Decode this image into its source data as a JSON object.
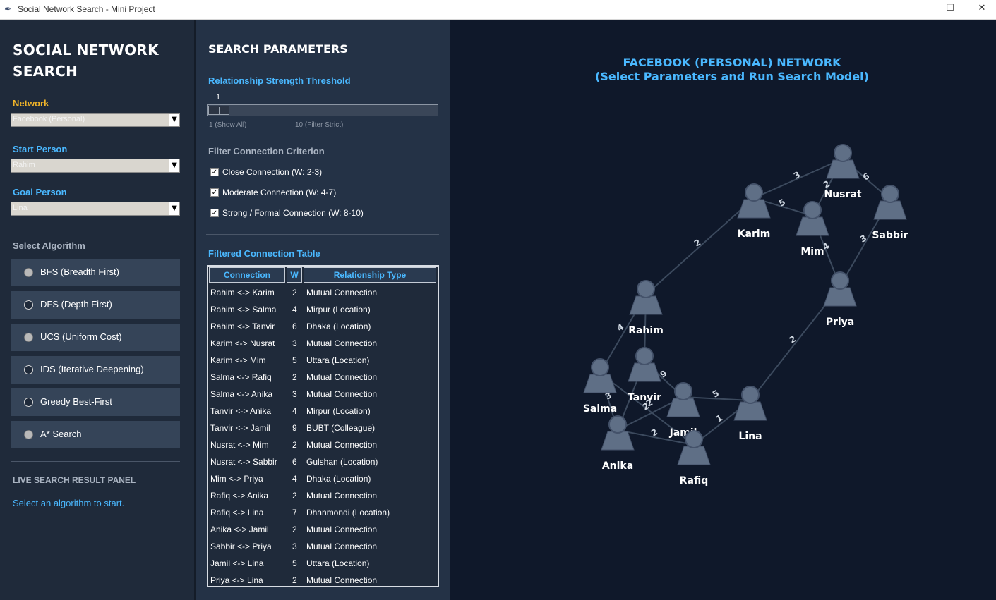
{
  "window": {
    "title": "Social Network Search - Mini Project",
    "minimize": "—",
    "maximize": "☐",
    "close": "✕"
  },
  "left": {
    "heading": "SOCIAL NETWORK SEARCH",
    "network_label": "Network",
    "network_value": "Facebook (Personal)",
    "start_label": "Start Person",
    "start_value": "Rahim",
    "goal_label": "Goal Person",
    "goal_value": "Lina",
    "algo_label": "Select Algorithm",
    "algorithms": [
      {
        "label": "BFS (Breadth First)",
        "filled": true
      },
      {
        "label": "DFS (Depth First)",
        "filled": false
      },
      {
        "label": "UCS (Uniform Cost)",
        "filled": true
      },
      {
        "label": "IDS (Iterative Deepening)",
        "filled": false
      },
      {
        "label": "Greedy Best-First",
        "filled": false
      },
      {
        "label": "A* Search",
        "filled": true
      }
    ],
    "live_title": "LIVE SEARCH RESULT PANEL",
    "live_message": "Select an algorithm to start."
  },
  "middle": {
    "heading": "SEARCH PARAMETERS",
    "threshold_label": "Relationship Strength Threshold",
    "threshold_value": "1",
    "threshold_min_label": "1 (Show All)",
    "threshold_max_label": "10 (Filter Strict)",
    "filter_title": "Filter Connection Criterion",
    "filters": [
      {
        "label": "Close Connection (W: 2-3)",
        "checked": true
      },
      {
        "label": "Moderate Connection (W: 4-7)",
        "checked": true
      },
      {
        "label": "Strong / Formal Connection (W: 8-10)",
        "checked": true
      }
    ],
    "table_title": "Filtered Connection Table",
    "table_headers": [
      "Connection",
      "W",
      "Relationship Type"
    ],
    "rows": [
      [
        "Rahim <-> Karim",
        "2",
        "Mutual Connection"
      ],
      [
        "Rahim <-> Salma",
        "4",
        "Mirpur (Location)"
      ],
      [
        "Rahim <-> Tanvir",
        "6",
        "Dhaka (Location)"
      ],
      [
        "Karim <-> Nusrat",
        "3",
        "Mutual Connection"
      ],
      [
        "Karim <-> Mim",
        "5",
        "Uttara (Location)"
      ],
      [
        "Salma <-> Rafiq",
        "2",
        "Mutual Connection"
      ],
      [
        "Salma <-> Anika",
        "3",
        "Mutual Connection"
      ],
      [
        "Tanvir <-> Anika",
        "4",
        "Mirpur (Location)"
      ],
      [
        "Tanvir <-> Jamil",
        "9",
        "BUBT (Colleague)"
      ],
      [
        "Nusrat <-> Mim",
        "2",
        "Mutual Connection"
      ],
      [
        "Nusrat <-> Sabbir",
        "6",
        "Gulshan (Location)"
      ],
      [
        "Mim <-> Priya",
        "4",
        "Dhaka (Location)"
      ],
      [
        "Rafiq <-> Anika",
        "2",
        "Mutual Connection"
      ],
      [
        "Rafiq <-> Lina",
        "7",
        "Dhanmondi (Location)"
      ],
      [
        "Anika <-> Jamil",
        "2",
        "Mutual Connection"
      ],
      [
        "Sabbir <-> Priya",
        "3",
        "Mutual Connection"
      ],
      [
        "Jamil <-> Lina",
        "5",
        "Uttara (Location)"
      ],
      [
        "Priya <-> Lina",
        "2",
        "Mutual Connection"
      ]
    ]
  },
  "graph": {
    "title_line1": "FACEBOOK (PERSONAL) NETWORK",
    "title_line2": "(Select Parameters and Run Search Model)",
    "nodes": [
      "Nusrat",
      "Karim",
      "Mim",
      "Sabbir",
      "Rahim",
      "Priya",
      "Salma",
      "Tanvir",
      "Jamil",
      "Lina",
      "Anika",
      "Rafiq"
    ],
    "edge_weights": [
      "3",
      "5",
      "2",
      "6",
      "2",
      "4",
      "3",
      "2",
      "4",
      "9",
      "3",
      "2",
      "5",
      "2",
      "1",
      "2"
    ],
    "colors": {
      "node": "#5f6f86",
      "edge": "#3c4a5e",
      "label": "#ffffff",
      "weight": "#d0d8e2"
    }
  }
}
